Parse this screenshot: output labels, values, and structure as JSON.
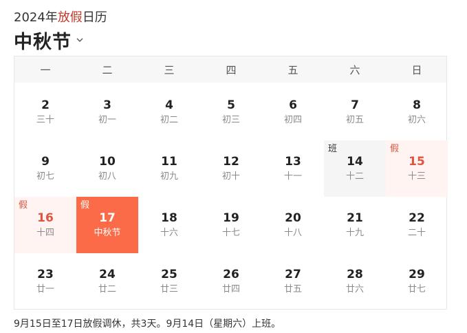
{
  "header": {
    "year_prefix": "2024年",
    "year_highlight": "放假",
    "year_suffix": "日历",
    "title": "中秋节"
  },
  "weekdays": [
    "一",
    "二",
    "三",
    "四",
    "五",
    "六",
    "日"
  ],
  "days": [
    {
      "num": "2",
      "lunar": "三十",
      "type": "normal",
      "badge": ""
    },
    {
      "num": "3",
      "lunar": "初一",
      "type": "normal",
      "badge": ""
    },
    {
      "num": "4",
      "lunar": "初二",
      "type": "normal",
      "badge": ""
    },
    {
      "num": "5",
      "lunar": "初三",
      "type": "normal",
      "badge": ""
    },
    {
      "num": "6",
      "lunar": "初四",
      "type": "normal",
      "badge": ""
    },
    {
      "num": "7",
      "lunar": "初五",
      "type": "normal",
      "badge": ""
    },
    {
      "num": "8",
      "lunar": "初六",
      "type": "normal",
      "badge": ""
    },
    {
      "num": "9",
      "lunar": "初七",
      "type": "normal",
      "badge": ""
    },
    {
      "num": "10",
      "lunar": "初八",
      "type": "normal",
      "badge": ""
    },
    {
      "num": "11",
      "lunar": "初九",
      "type": "normal",
      "badge": ""
    },
    {
      "num": "12",
      "lunar": "初十",
      "type": "normal",
      "badge": ""
    },
    {
      "num": "13",
      "lunar": "十一",
      "type": "normal",
      "badge": ""
    },
    {
      "num": "14",
      "lunar": "十二",
      "type": "work",
      "badge": "班"
    },
    {
      "num": "15",
      "lunar": "十三",
      "type": "holiday",
      "badge": "假"
    },
    {
      "num": "16",
      "lunar": "十四",
      "type": "holiday",
      "badge": "假"
    },
    {
      "num": "17",
      "lunar": "中秋节",
      "type": "selected",
      "badge": "假"
    },
    {
      "num": "18",
      "lunar": "十六",
      "type": "normal",
      "badge": ""
    },
    {
      "num": "19",
      "lunar": "十七",
      "type": "normal",
      "badge": ""
    },
    {
      "num": "20",
      "lunar": "十八",
      "type": "normal",
      "badge": ""
    },
    {
      "num": "21",
      "lunar": "十九",
      "type": "normal",
      "badge": ""
    },
    {
      "num": "22",
      "lunar": "二十",
      "type": "normal",
      "badge": ""
    },
    {
      "num": "23",
      "lunar": "廿一",
      "type": "normal",
      "badge": ""
    },
    {
      "num": "24",
      "lunar": "廿二",
      "type": "normal",
      "badge": ""
    },
    {
      "num": "25",
      "lunar": "廿三",
      "type": "normal",
      "badge": ""
    },
    {
      "num": "26",
      "lunar": "廿四",
      "type": "normal",
      "badge": ""
    },
    {
      "num": "27",
      "lunar": "廿五",
      "type": "normal",
      "badge": ""
    },
    {
      "num": "28",
      "lunar": "廿六",
      "type": "normal",
      "badge": ""
    },
    {
      "num": "29",
      "lunar": "廿七",
      "type": "normal",
      "badge": ""
    }
  ],
  "note": "9月15日至17日放假调休，共3天。9月14日（星期六）上班。",
  "colors": {
    "accent": "#fb6b47",
    "holiday_text": "#e0533f",
    "holiday_bg": "#fff4f2",
    "work_bg": "#f5f5f5"
  }
}
